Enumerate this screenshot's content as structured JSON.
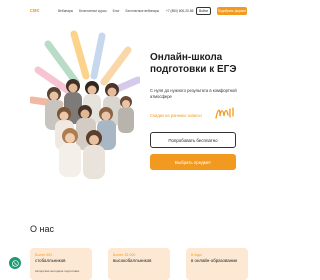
{
  "header": {
    "logo": "смс",
    "nav": [
      "Вебинары",
      "Бесплатные курсы",
      "Блог",
      "Бесплатные вебинары"
    ],
    "phone": "+7 (800) 600-20-56",
    "login_label": "Войти",
    "signup_label": "Подобрать формат"
  },
  "hero": {
    "title": "Онлайн-школа подготовки к ЕГЭ",
    "subtitle": "С нуля до нужного результата в комфортной атмосфере",
    "promo": "Скидки на раннюю запись!",
    "try_label": "Попробовать бесплатно",
    "choose_label": "Выбрать предмет"
  },
  "about": {
    "title": "О нас",
    "cards": [
      {
        "title": "Более 891",
        "text": "стобалльников",
        "small": "Авторская методика подготовки"
      },
      {
        "title": "Более 35 000",
        "text": "высокобалльников",
        "small": ""
      },
      {
        "title": "8 годы",
        "text": "в онлайн-образовании",
        "small": ""
      }
    ]
  },
  "colors": {
    "accent": "#f29a1f",
    "accent_light": "#fde9d3",
    "chat": "#1f9a74"
  },
  "icons": {
    "chat": "whatsapp-icon",
    "decor": "squiggle-icon"
  }
}
